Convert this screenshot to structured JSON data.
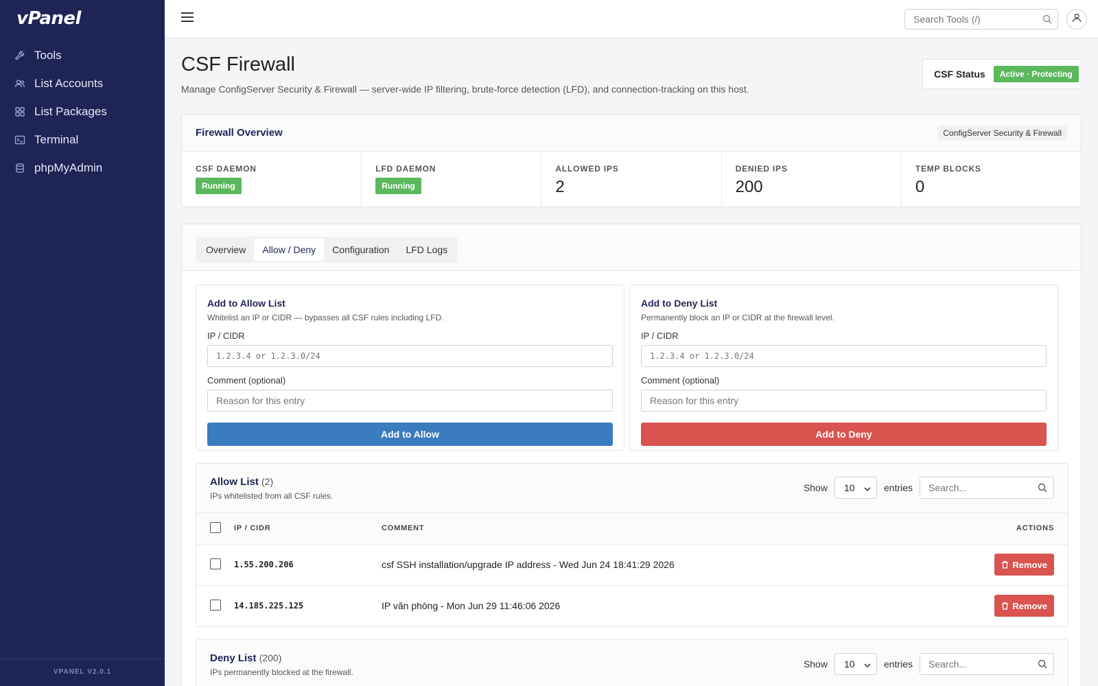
{
  "app": {
    "brand": "vPanel",
    "version": "VPANEL V2.0.1"
  },
  "sidebar": {
    "items": [
      {
        "label": "Tools",
        "icon": "wrench-icon"
      },
      {
        "label": "List Accounts",
        "icon": "users-icon"
      },
      {
        "label": "List Packages",
        "icon": "grid-icon"
      },
      {
        "label": "Terminal",
        "icon": "terminal-icon"
      },
      {
        "label": "phpMyAdmin",
        "icon": "database-icon"
      }
    ]
  },
  "topbar": {
    "search_placeholder": "Search Tools (/)"
  },
  "page": {
    "title": "CSF Firewall",
    "description": "Manage ConfigServer Security & Firewall — server-wide IP filtering, brute-force detection (LFD), and connection-tracking on this host.",
    "status_label": "CSF Status",
    "status_value": "Active · Protecting"
  },
  "overview": {
    "title": "Firewall Overview",
    "tag": "ConfigServer Security & Firewall",
    "stats": [
      {
        "label": "CSF DAEMON",
        "value": "Running"
      },
      {
        "label": "LFD DAEMON",
        "value": "Running"
      },
      {
        "label": "ALLOWED IPS",
        "value": "2"
      },
      {
        "label": "DENIED IPS",
        "value": "200"
      },
      {
        "label": "TEMP BLOCKS",
        "value": "0"
      }
    ]
  },
  "tabs": [
    "Overview",
    "Allow / Deny",
    "Configuration",
    "LFD Logs"
  ],
  "allow_form": {
    "title": "Add to Allow List",
    "description": "Whitelist an IP or CIDR — bypasses all CSF rules including LFD.",
    "ip_label": "IP / CIDR",
    "ip_placeholder": "1.2.3.4 or 1.2.3.0/24",
    "comment_label": "Comment (optional)",
    "comment_placeholder": "Reason for this entry",
    "button": "Add to Allow"
  },
  "deny_form": {
    "title": "Add to Deny List",
    "description": "Permanently block an IP or CIDR at the firewall level.",
    "ip_label": "IP / CIDR",
    "ip_placeholder": "1.2.3.4 or 1.2.3.0/24",
    "comment_label": "Comment (optional)",
    "comment_placeholder": "Reason for this entry",
    "button": "Add to Deny"
  },
  "allow_list": {
    "title": "Allow List",
    "count": "(2)",
    "description": "IPs whitelisted from all CSF rules.",
    "show_label": "Show",
    "entries_value": "10",
    "entries_label": "entries",
    "search_placeholder": "Search...",
    "columns": {
      "ip": "IP / CIDR",
      "comment": "COMMENT",
      "actions": "ACTIONS"
    },
    "rows": [
      {
        "ip": "1.55.200.206",
        "comment": "csf SSH installation/upgrade IP address - Wed Jun 24 18:41:29 2026",
        "action": "Remove"
      },
      {
        "ip": "14.185.225.125",
        "comment": "IP văn phòng - Mon Jun 29 11:46:06 2026",
        "action": "Remove"
      }
    ]
  },
  "deny_list": {
    "title": "Deny List",
    "count": "(200)",
    "description": "IPs permanently blocked at the firewall.",
    "show_label": "Show",
    "entries_value": "10",
    "entries_label": "entries",
    "search_placeholder": "Search..."
  },
  "colors": {
    "sidebar": "#1f2457",
    "success": "#5cb85c",
    "primary": "#3b7bbf",
    "danger": "#d9534f"
  }
}
